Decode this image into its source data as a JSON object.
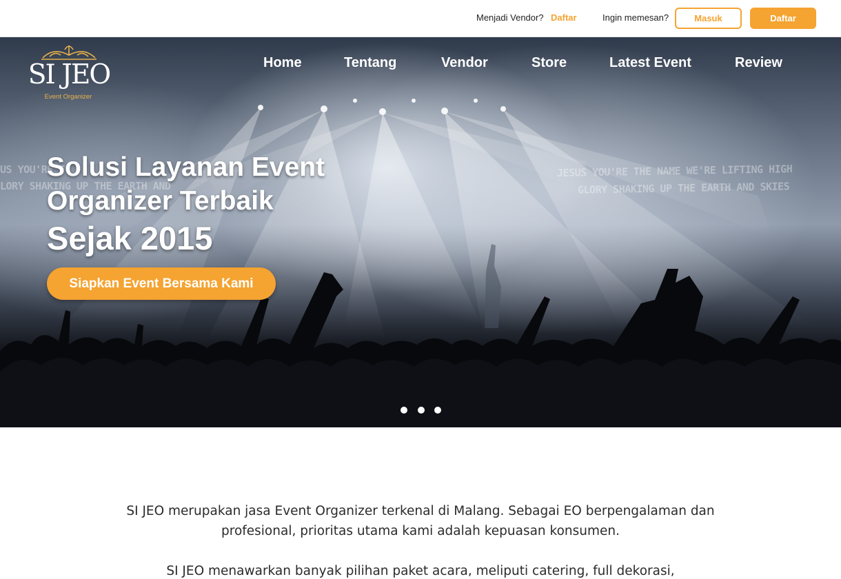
{
  "topbar": {
    "vendor_question": "Menjadi Vendor?",
    "vendor_link": "Daftar",
    "order_question": "Ingin memesan?",
    "login_button": "Masuk",
    "register_button": "Daftar"
  },
  "logo": {
    "mark": "SI JEO",
    "subtitle": "Event Organizer"
  },
  "nav": {
    "items": [
      {
        "label": "Home"
      },
      {
        "label": "Tentang"
      },
      {
        "label": "Vendor"
      },
      {
        "label": "Store"
      },
      {
        "label": "Latest Event"
      },
      {
        "label": "Review"
      }
    ]
  },
  "hero": {
    "title": "Solusi Layanan Event Organizer Terbaik",
    "year_line": "Sejak 2015",
    "cta": "Siapkan Event Bersama Kami",
    "background_text_left_1": "US YOU'RE T",
    "background_text_left_2": "LORY SHAKING UP THE EARTH AND",
    "background_text_right_1": "JESUS YOU'RE THE NAME WE'RE LIFTING HIGH",
    "background_text_right_2": "GLORY SHAKING UP THE EARTH AND SKIES",
    "slides_count": 3
  },
  "about": {
    "paragraph_1": "SI JEO merupakan jasa Event Organizer terkenal di Malang. Sebagai EO berpengalaman dan profesional, prioritas utama kami adalah kepuasan konsumen.",
    "paragraph_2": "SI JEO menawarkan banyak pilihan paket acara, meliputi catering, full dekorasi,"
  },
  "colors": {
    "accent": "#f5a331",
    "logo_gold": "#e8b24a",
    "text_dark": "#2b2b2b"
  }
}
